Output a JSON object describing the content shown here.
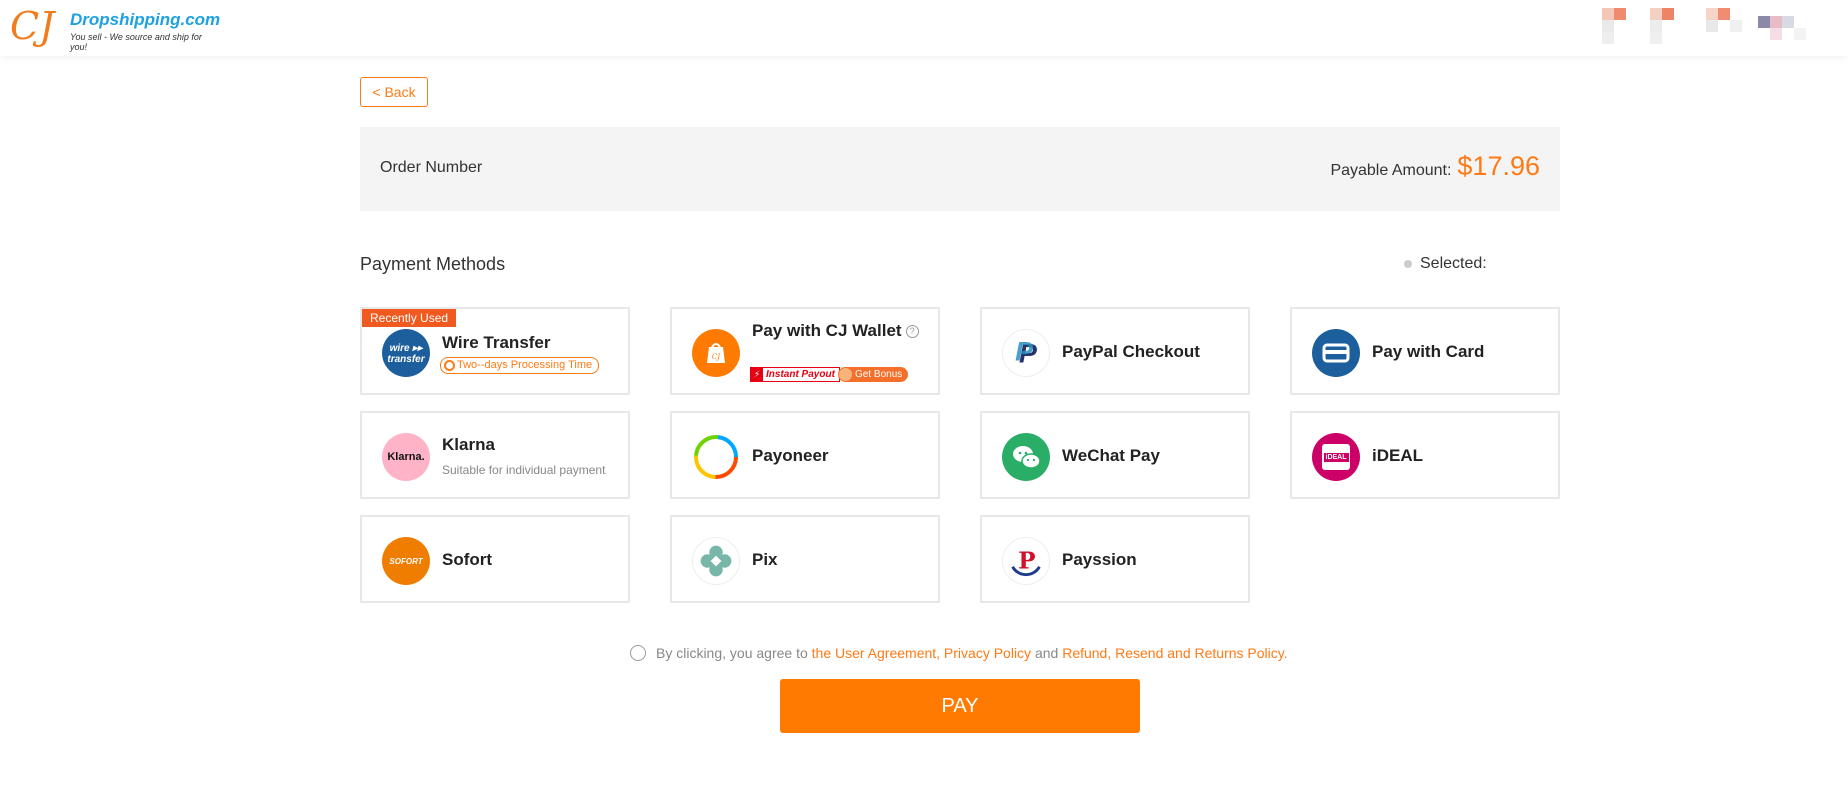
{
  "header": {
    "logo_mark": "CJ",
    "brand": "Dropshipping.com",
    "tagline": "You sell - We source and ship for you!"
  },
  "back_label": "< Back",
  "order": {
    "number_label": "Order Number",
    "payable_label": "Payable Amount:",
    "payable_amount": "$17.96"
  },
  "payment_methods": {
    "title": "Payment Methods",
    "selected_label": "Selected:",
    "items": [
      {
        "name": "Wire Transfer",
        "badge": "Recently Used",
        "note": "Two--days Processing Time",
        "icon": "wire-transfer-icon"
      },
      {
        "name": "Pay with CJ Wallet",
        "tag1": "Instant Payout",
        "tag2": "Get Bonus",
        "icon": "cj-wallet-icon"
      },
      {
        "name": "PayPal Checkout",
        "icon": "paypal-icon"
      },
      {
        "name": "Pay with Card",
        "icon": "card-icon"
      },
      {
        "name": "Klarna",
        "sub": "Suitable for individual payment",
        "icon_text": "Klarna.",
        "icon": "klarna-icon"
      },
      {
        "name": "Payoneer",
        "icon": "payoneer-icon"
      },
      {
        "name": "WeChat Pay",
        "icon": "wechat-icon"
      },
      {
        "name": "iDEAL",
        "icon_text": "iDEAL",
        "icon": "ideal-icon"
      },
      {
        "name": "Sofort",
        "icon_text": "SOFORT",
        "icon": "sofort-icon"
      },
      {
        "name": "Pix",
        "icon": "pix-icon"
      },
      {
        "name": "Payssion",
        "icon_text": "P",
        "icon": "payssion-icon"
      }
    ]
  },
  "agreement": {
    "prefix": "By clicking, you agree to",
    "link1": "the User Agreement, Privacy Policy",
    "middle": "and",
    "link2": "Refund, Resend and Returns Policy."
  },
  "pay_label": "PAY",
  "colors": {
    "accent": "#ff7a00",
    "brand_blue": "#1da1e2"
  }
}
